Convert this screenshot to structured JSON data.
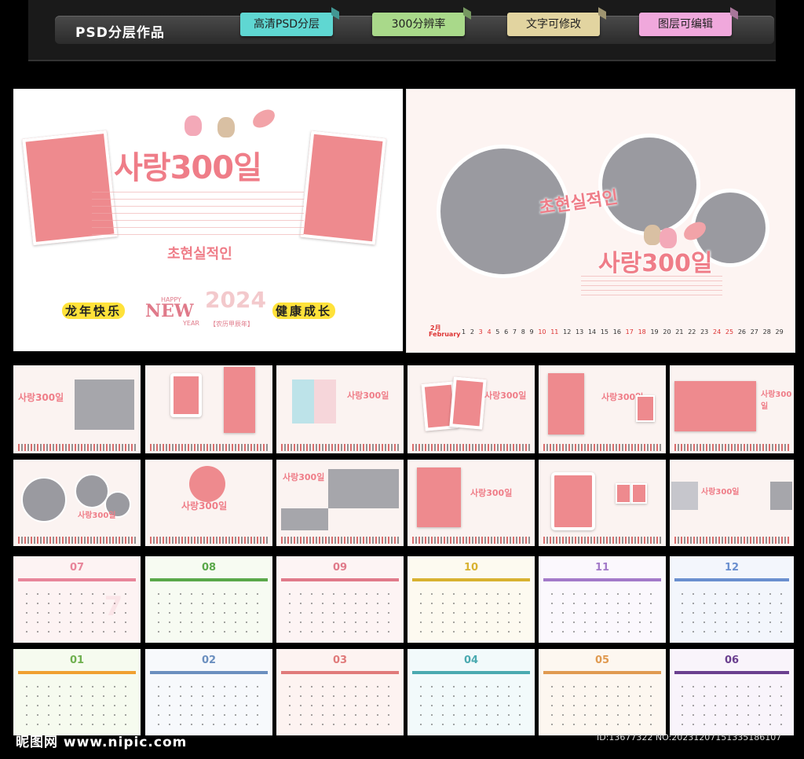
{
  "header": {
    "title": "PSD分层作品",
    "tags": [
      {
        "label": "高清PSD分层",
        "color": "#5fd7d2"
      },
      {
        "label": "300分辨率",
        "color": "#a9d98a"
      },
      {
        "label": "文字可修改",
        "color": "#e2d4a0"
      },
      {
        "label": "图层可编辑",
        "color": "#f0a8dc"
      }
    ]
  },
  "cover": {
    "korean_title": "사랑300일",
    "sub_korean": "초현실적인",
    "slogan_left": "龙年快乐",
    "slogan_right": "健康成长",
    "happy": "HAPPY",
    "new": "NEW",
    "year": "YEAR",
    "year_num": "2024",
    "lunar": "【农历甲辰年】"
  },
  "feature": {
    "korean_a": "초현실적인",
    "korean_b": "사랑300일",
    "month_num": "2月",
    "month_name": "February",
    "days": [
      "1",
      "2",
      "3",
      "4",
      "5",
      "6",
      "7",
      "8",
      "9",
      "10",
      "11",
      "12",
      "13",
      "14",
      "15",
      "16",
      "17",
      "18",
      "19",
      "20",
      "21",
      "22",
      "23",
      "24",
      "25",
      "26",
      "27",
      "28",
      "29"
    ]
  },
  "months_row1": [
    "07",
    "08",
    "09",
    "10",
    "11",
    "12"
  ],
  "months_row2": [
    "01",
    "02",
    "03",
    "04",
    "05",
    "06"
  ],
  "month_colors_row1": [
    "#e8859a",
    "#5aa84a",
    "#e07a8a",
    "#d8b230",
    "#a37ac9",
    "#6a8fcf"
  ],
  "month_colors_row2": [
    "#6fb04f",
    "#6b8fbf",
    "#e07a7a",
    "#4aaab0",
    "#e09a50",
    "#6a3f8f"
  ],
  "footer": {
    "watermark": "昵图网 www.nipic.com",
    "id": "ID:13677322 NO:20231207151335186107"
  }
}
